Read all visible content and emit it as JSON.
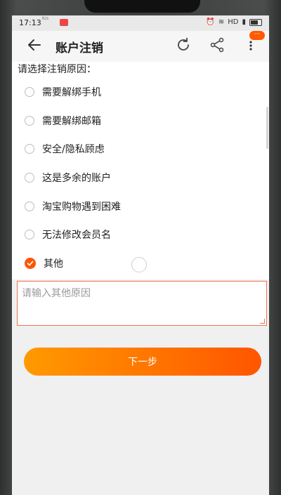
{
  "status": {
    "time": "17:13",
    "mini_text": "K/s",
    "right_text": "HD",
    "right_time": "10:10"
  },
  "appbar": {
    "title": "账户注销",
    "badge": "···"
  },
  "form": {
    "prompt": "请选择注销原因：",
    "options": [
      {
        "label": "需要解绑手机",
        "checked": false
      },
      {
        "label": "需要解绑邮箱",
        "checked": false
      },
      {
        "label": "安全/隐私顾虑",
        "checked": false
      },
      {
        "label": "这是多余的账户",
        "checked": false
      },
      {
        "label": "淘宝购物遇到困难",
        "checked": false
      },
      {
        "label": "无法修改会员名",
        "checked": false
      },
      {
        "label": "其他",
        "checked": true
      }
    ],
    "other_placeholder": "请输入其他原因",
    "next_label": "下一步"
  },
  "colors": {
    "accent": "#ff5500",
    "button_gradient_start": "#ff9a00",
    "button_gradient_end": "#ff5500",
    "input_border": "#f0734c"
  }
}
